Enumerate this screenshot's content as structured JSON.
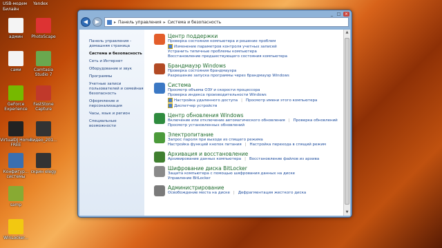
{
  "desktop": {
    "top_texts": [
      "USB-модем",
      "Билайн",
      "Yandex"
    ],
    "icons": [
      {
        "label": "админ",
        "icon": "document-icon",
        "color": "#f4f4f4"
      },
      {
        "label": "PhotoScape",
        "icon": "photoscape-icon",
        "color": "#d33"
      },
      {
        "label": "сами",
        "icon": "document-icon",
        "color": "#f4f4f4"
      },
      {
        "label": "Camtasia Studio 7",
        "icon": "camtasia-icon",
        "color": "#6aa84f"
      },
      {
        "label": "GeForce Experience",
        "icon": "geforce-icon",
        "color": "#76b900"
      },
      {
        "label": "FastStone Capture",
        "icon": "faststone-icon",
        "color": "#c0392b"
      },
      {
        "label": "VirtualDJ Home FREE",
        "icon": "virtualdj-icon",
        "color": "#222"
      },
      {
        "label": "Видео_201...",
        "icon": "video-file-icon",
        "color": "#333"
      },
      {
        "label": "Конфигур... системы",
        "icon": "config-icon",
        "color": "#3a6fb0"
      },
      {
        "label": "скрин elegy",
        "icon": "image-icon",
        "color": "#333"
      },
      {
        "label": "samp",
        "icon": "samp-icon",
        "color": "#8a3"
      },
      {
        "label": "WinLocker...",
        "icon": "radiation-icon",
        "color": "#f2c811"
      }
    ]
  },
  "window": {
    "breadcrumb": [
      "Панель управления",
      "Система и безопасность"
    ],
    "left_nav": [
      {
        "label": "Панель управления - домашняя страница",
        "current": false
      },
      {
        "label": "Система и безопасность",
        "current": true
      },
      {
        "label": "Сеть и Интернет",
        "current": false
      },
      {
        "label": "Оборудование и звук",
        "current": false
      },
      {
        "label": "Программы",
        "current": false
      },
      {
        "label": "Учетные записи пользователей и семейная безопасность",
        "current": false
      },
      {
        "label": "Оформление и персонализация",
        "current": false
      },
      {
        "label": "Часы, язык и регион",
        "current": false
      },
      {
        "label": "Специальные возможности",
        "current": false
      }
    ],
    "categories": [
      {
        "title": "Центр поддержки",
        "icon": "support-center-icon",
        "color": "#e35d2a",
        "lines": [
          [
            {
              "text": "Проверка состояния компьютера и решение проблем",
              "shield": false
            }
          ],
          [
            {
              "text": "Изменение параметров контроля учетных записей",
              "shield": true
            }
          ],
          [
            {
              "text": "Устранить типичные проблемы компьютера",
              "shield": false
            }
          ],
          [
            {
              "text": "Восстановление предшествующего состояния компьютера",
              "shield": false
            }
          ]
        ]
      },
      {
        "title": "Брандмауэр Windows",
        "icon": "firewall-icon",
        "color": "#b24a24",
        "lines": [
          [
            {
              "text": "Проверка состояния брандмауэра",
              "shield": false
            }
          ],
          [
            {
              "text": "Разрешение запуска программы через брандмауэр Windows",
              "shield": false
            }
          ]
        ]
      },
      {
        "title": "Система",
        "icon": "system-icon",
        "color": "#3a78c4",
        "lines": [
          [
            {
              "text": "Просмотр объема ОЗУ и скорости процессора",
              "shield": false
            }
          ],
          [
            {
              "text": "Проверка индекса производительности Windows",
              "shield": false
            }
          ],
          [
            {
              "text": "Настройка удаленного доступа",
              "shield": true
            },
            {
              "text": "Просмотр имени этого компьютера",
              "shield": false
            }
          ],
          [
            {
              "text": "Диспетчер устройств",
              "shield": true
            }
          ]
        ]
      },
      {
        "title": "Центр обновления Windows",
        "icon": "windows-update-icon",
        "color": "#2e8b3e",
        "lines": [
          [
            {
              "text": "Включение или отключение автоматического обновления",
              "shield": false
            },
            {
              "text": "Проверка обновлений",
              "shield": false
            }
          ],
          [
            {
              "text": "Просмотр установленных обновлений",
              "shield": false
            }
          ]
        ]
      },
      {
        "title": "Электропитание",
        "icon": "power-options-icon",
        "color": "#4b9a3a",
        "lines": [
          [
            {
              "text": "Запрос пароля при выходе из спящего режима",
              "shield": false
            }
          ],
          [
            {
              "text": "Настройка функций кнопок питания",
              "shield": false
            },
            {
              "text": "Настройка перехода в спящий режим",
              "shield": false
            }
          ]
        ]
      },
      {
        "title": "Архивация и восстановление",
        "icon": "backup-icon",
        "color": "#3f7f2f",
        "lines": [
          [
            {
              "text": "Архивирование данных компьютера",
              "shield": false
            },
            {
              "text": "Восстановление файлов из архива",
              "shield": false
            }
          ]
        ]
      },
      {
        "title": "Шифрование диска BitLocker",
        "icon": "bitlocker-icon",
        "color": "#8a8a8a",
        "lines": [
          [
            {
              "text": "Защита компьютера с помощью шифрования данных на диске",
              "shield": false
            }
          ],
          [
            {
              "text": "Управление BitLocker",
              "shield": false
            }
          ]
        ]
      },
      {
        "title": "Администрирование",
        "icon": "administration-icon",
        "color": "#7a7a7a",
        "lines": [
          [
            {
              "text": "Освобождение места на диске",
              "shield": false
            },
            {
              "text": "Дефрагментация жесткого диска",
              "shield": false
            }
          ]
        ]
      }
    ]
  }
}
